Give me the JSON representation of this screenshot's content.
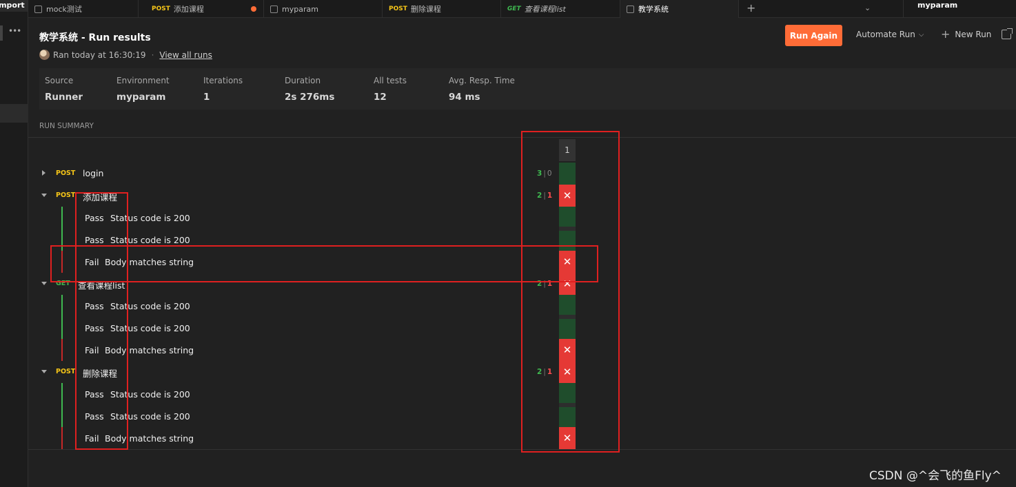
{
  "sidebar": {
    "import_label": "Import",
    "more": "•••"
  },
  "tabs": [
    {
      "label": "mock测试",
      "method": "",
      "icon": "collection-icon"
    },
    {
      "label": "添加课程",
      "method": "POST",
      "unsaved": true
    },
    {
      "label": "myparam",
      "method": "",
      "icon": "environment-icon"
    },
    {
      "label": "删除课程",
      "method": "POST"
    },
    {
      "label": "查看课程list",
      "method": "GET"
    },
    {
      "label": "教学系统",
      "method": "",
      "icon": "runner-icon",
      "active": true
    }
  ],
  "environment": "myparam",
  "header": {
    "title": "教学系统 - Run results",
    "ran": "Ran today at 16:30:19",
    "sep": "·",
    "view_all": "View all runs",
    "run_again": "Run Again",
    "automate": "Automate Run",
    "new_run": "New Run"
  },
  "stats": [
    {
      "label": "Source",
      "value": "Runner"
    },
    {
      "label": "Environment",
      "value": "myparam"
    },
    {
      "label": "Iterations",
      "value": "1"
    },
    {
      "label": "Duration",
      "value": "2s 276ms"
    },
    {
      "label": "All tests",
      "value": "12"
    },
    {
      "label": "Avg. Resp. Time",
      "value": "94 ms"
    }
  ],
  "summary_label": "RUN SUMMARY",
  "iteration_header": "1",
  "requests": [
    {
      "method": "POST",
      "name": "login",
      "pass": "3",
      "fail": "0",
      "expanded": false,
      "tests": []
    },
    {
      "method": "POST",
      "name": "添加课程",
      "pass": "2",
      "fail": "1",
      "expanded": true,
      "tests": [
        {
          "status": "Pass",
          "name": "Status code is 200"
        },
        {
          "status": "Pass",
          "name": "Status code is 200"
        },
        {
          "status": "Fail",
          "name": "Body matches string"
        }
      ]
    },
    {
      "method": "GET",
      "name": "查看课程list",
      "pass": "2",
      "fail": "1",
      "expanded": true,
      "tests": [
        {
          "status": "Pass",
          "name": "Status code is 200"
        },
        {
          "status": "Pass",
          "name": "Status code is 200"
        },
        {
          "status": "Fail",
          "name": "Body matches string"
        }
      ]
    },
    {
      "method": "POST",
      "name": "删除课程",
      "pass": "2",
      "fail": "1",
      "expanded": true,
      "tests": [
        {
          "status": "Pass",
          "name": "Status code is 200"
        },
        {
          "status": "Pass",
          "name": "Status code is 200"
        },
        {
          "status": "Fail",
          "name": "Body matches string"
        }
      ]
    }
  ],
  "fail_glyph": "✕",
  "count_sep": "|",
  "watermark": "CSDN @^会飞的鱼Fly^",
  "colors": {
    "accent": "#ff6c37",
    "pass": "#3fb950",
    "fail": "#e53935",
    "annotation": "#e02020"
  }
}
